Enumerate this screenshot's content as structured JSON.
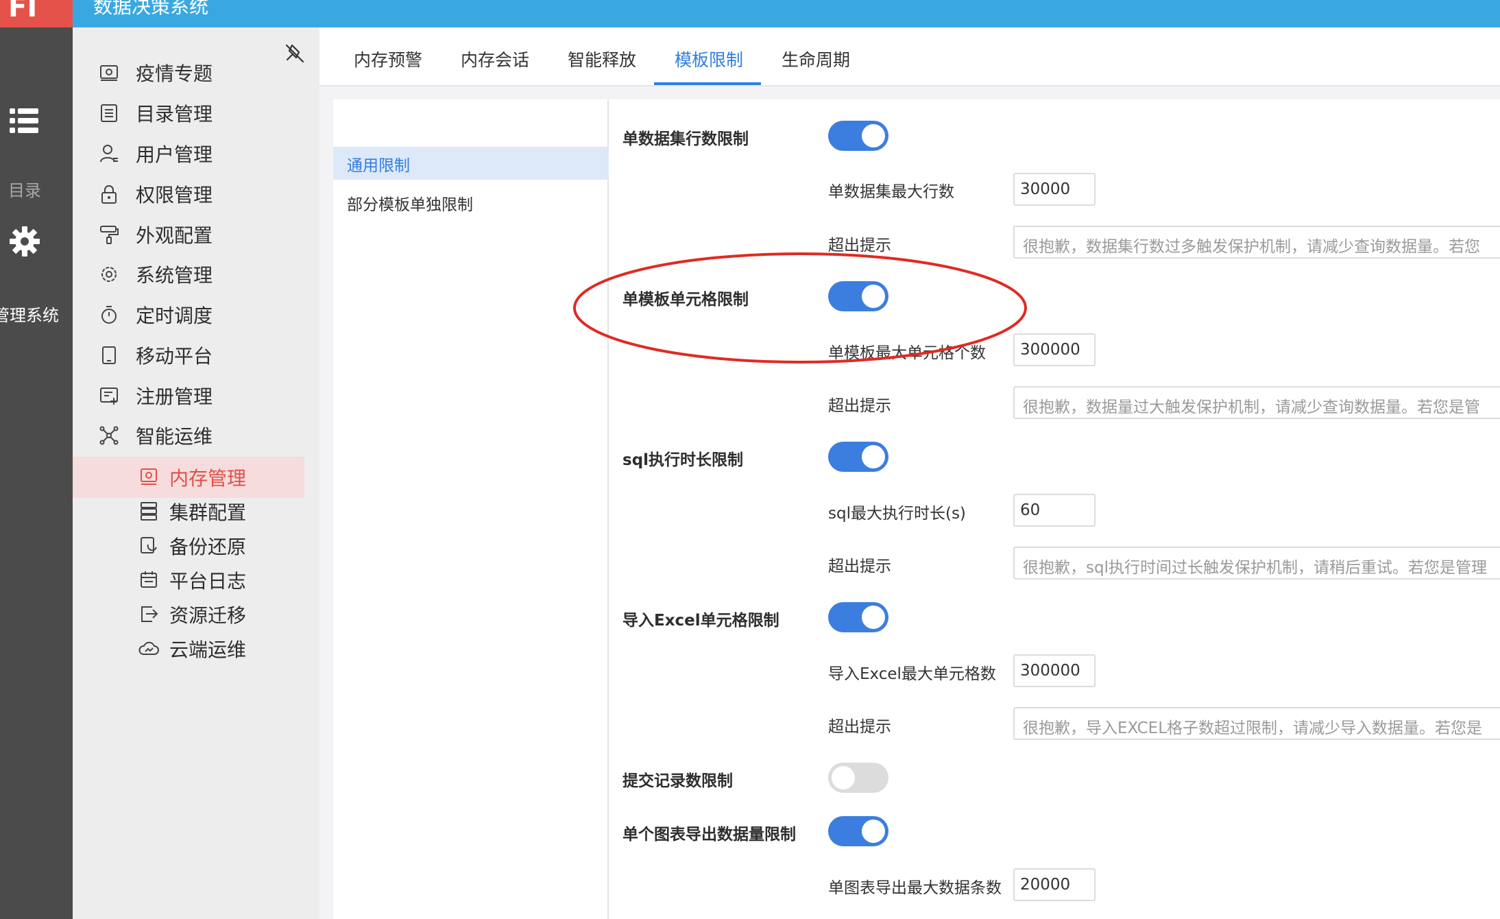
{
  "app": {
    "logo_text": "FI",
    "title": "数据决策系统"
  },
  "rail": {
    "catalog_label": "目录",
    "admin_label": "管理系统"
  },
  "leftnav": {
    "items": [
      {
        "label": "疫情专题",
        "icon": "dashboard-icon"
      },
      {
        "label": "目录管理",
        "icon": "list-icon"
      },
      {
        "label": "用户管理",
        "icon": "user-icon"
      },
      {
        "label": "权限管理",
        "icon": "lock-icon"
      },
      {
        "label": "外观配置",
        "icon": "paint-roller-icon"
      },
      {
        "label": "系统管理",
        "icon": "gear-icon"
      },
      {
        "label": "定时调度",
        "icon": "timer-icon"
      },
      {
        "label": "移动平台",
        "icon": "tablet-icon"
      },
      {
        "label": "注册管理",
        "icon": "register-icon"
      },
      {
        "label": "智能运维",
        "icon": "network-icon"
      }
    ],
    "subitems": [
      {
        "label": "内存管理",
        "icon": "memory-icon",
        "active": true
      },
      {
        "label": "集群配置",
        "icon": "server-icon"
      },
      {
        "label": "备份还原",
        "icon": "backup-icon"
      },
      {
        "label": "平台日志",
        "icon": "calendar-log-icon"
      },
      {
        "label": "资源迁移",
        "icon": "export-icon"
      },
      {
        "label": "云端运维",
        "icon": "cloud-icon"
      }
    ]
  },
  "tabs": [
    {
      "label": "内存预警"
    },
    {
      "label": "内存会话"
    },
    {
      "label": "智能释放"
    },
    {
      "label": "模板限制",
      "active": true
    },
    {
      "label": "生命周期"
    }
  ],
  "subnav": [
    {
      "label": "通用限制",
      "active": true
    },
    {
      "label": "部分模板单独限制"
    }
  ],
  "settings": {
    "s1": {
      "label": "单数据集行数限制",
      "enabled": true,
      "max_label": "单数据集最大行数",
      "max_value": "30000",
      "tip_label": "超出提示",
      "tip_value": "很抱歉，数据集行数过多触发保护机制，请减少查询数据量。若您"
    },
    "s2": {
      "label": "单模板单元格限制",
      "enabled": true,
      "max_label": "单模板最大单元格个数",
      "max_value": "300000",
      "tip_label": "超出提示",
      "tip_value": "很抱歉，数据量过大触发保护机制，请减少查询数据量。若您是管"
    },
    "s3": {
      "label": "sql执行时长限制",
      "enabled": true,
      "max_label": "sql最大执行时长(s)",
      "max_value": "60",
      "tip_label": "超出提示",
      "tip_value": "很抱歉，sql执行时间过长触发保护机制，请稍后重试。若您是管理"
    },
    "s4": {
      "label": "导入Excel单元格限制",
      "enabled": true,
      "max_label": "导入Excel最大单元格数",
      "max_value": "300000",
      "tip_label": "超出提示",
      "tip_value": "很抱歉，导入EXCEL格子数超过限制，请减少导入数据量。若您是"
    },
    "s5": {
      "label": "提交记录数限制",
      "enabled": false
    },
    "s6": {
      "label": "单个图表导出数据量限制",
      "enabled": true,
      "max_label": "单图表导出最大数据条数",
      "max_value": "20000"
    }
  },
  "colors": {
    "topbar": "#3aa8e0",
    "logo": "#e5524a",
    "accent": "#2f7de1",
    "toggle_on": "#3b7ee0",
    "annotation": "#e02a22"
  }
}
